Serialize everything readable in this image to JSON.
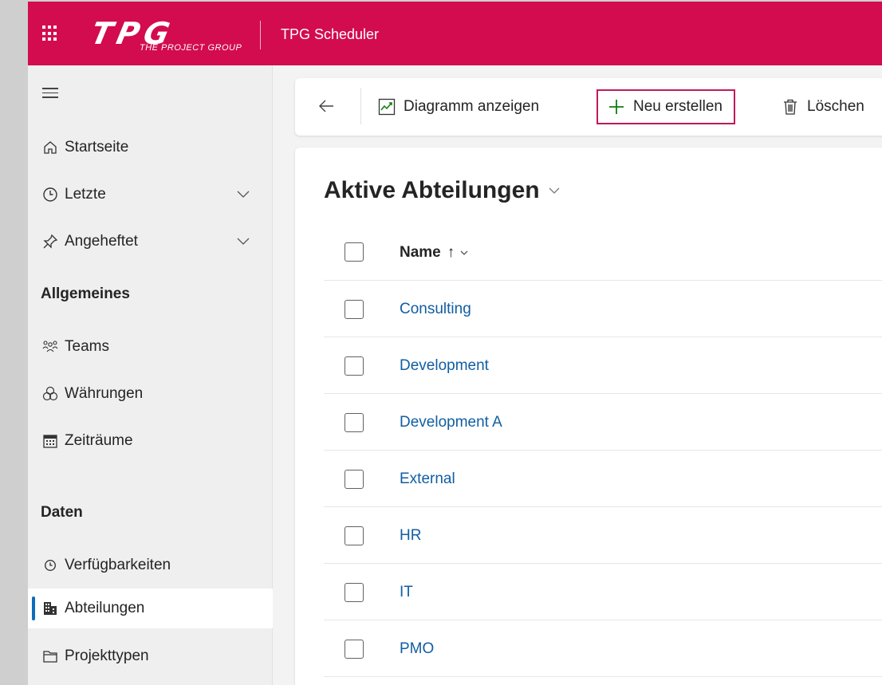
{
  "header": {
    "app_title": "TPG Scheduler",
    "logo_mark": "TPG",
    "logo_subtitle": "THE PROJECT GROUP",
    "brand_color": "#d30b4f"
  },
  "sidebar": {
    "items_top": [
      {
        "label": "Startseite",
        "icon": "home-icon"
      },
      {
        "label": "Letzte",
        "icon": "clock-icon",
        "expandable": true
      },
      {
        "label": "Angeheftet",
        "icon": "pin-icon",
        "expandable": true
      }
    ],
    "section_general": "Allgemeines",
    "items_general": [
      {
        "label": "Teams",
        "icon": "people-icon"
      },
      {
        "label": "Währungen",
        "icon": "currency-icon"
      },
      {
        "label": "Zeiträume",
        "icon": "calendar-icon"
      }
    ],
    "section_data": "Daten",
    "items_data": [
      {
        "label": "Verfügbarkeiten",
        "icon": "clock-icon"
      },
      {
        "label": "Abteilungen",
        "icon": "building-icon",
        "active": true
      },
      {
        "label": "Projekttypen",
        "icon": "folder-icon"
      }
    ]
  },
  "toolbar": {
    "chart_label": "Diagramm anzeigen",
    "new_label": "Neu erstellen",
    "delete_label": "Löschen",
    "new_highlight_color": "#c2185b"
  },
  "view": {
    "title": "Aktive Abteilungen",
    "column_name": "Name",
    "sort_indicator": "↑",
    "rows": [
      "Consulting",
      "Development",
      "Development A",
      "External",
      "HR",
      "IT",
      "PMO"
    ]
  }
}
